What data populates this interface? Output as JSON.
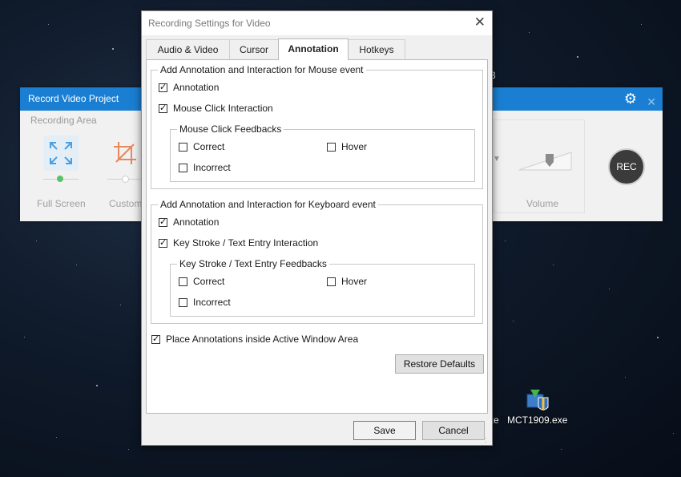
{
  "background_window": {
    "title": "Record Video Project",
    "recording_area_label": "Recording Area",
    "full_screen_label": "Full Screen",
    "custom_label": "Custom",
    "volume_label": "Volume",
    "rec_label": "REC",
    "partial_text": "3",
    "accent_color": "#1a7fd3"
  },
  "desktop": {
    "icon_label": "MCT1909.exe",
    "partial_label": "xe"
  },
  "dialog": {
    "title": "Recording Settings for Video",
    "tabs": [
      {
        "label": "Audio & Video",
        "active": false
      },
      {
        "label": "Cursor",
        "active": false
      },
      {
        "label": "Annotation",
        "active": true
      },
      {
        "label": "Hotkeys",
        "active": false
      }
    ],
    "mouse_group": {
      "title": "Add Annotation and Interaction for Mouse event",
      "annotation": {
        "label": "Annotation",
        "checked": true
      },
      "interaction": {
        "label": "Mouse Click Interaction",
        "checked": true
      },
      "feedbacks": {
        "title": "Mouse Click Feedbacks",
        "correct": {
          "label": "Correct",
          "checked": false
        },
        "hover": {
          "label": "Hover",
          "checked": false
        },
        "incorrect": {
          "label": "Incorrect",
          "checked": false
        }
      }
    },
    "keyboard_group": {
      "title": "Add Annotation and Interaction for Keyboard event",
      "annotation": {
        "label": "Annotation",
        "checked": true
      },
      "interaction": {
        "label": "Key Stroke / Text Entry Interaction",
        "checked": true
      },
      "feedbacks": {
        "title": "Key Stroke / Text Entry Feedbacks",
        "correct": {
          "label": "Correct",
          "checked": false
        },
        "hover": {
          "label": "Hover",
          "checked": false
        },
        "incorrect": {
          "label": "Incorrect",
          "checked": false
        }
      }
    },
    "place_inside": {
      "label": "Place Annotations inside Active Window Area",
      "checked": true
    },
    "restore_defaults_label": "Restore Defaults",
    "save_label": "Save",
    "cancel_label": "Cancel"
  }
}
